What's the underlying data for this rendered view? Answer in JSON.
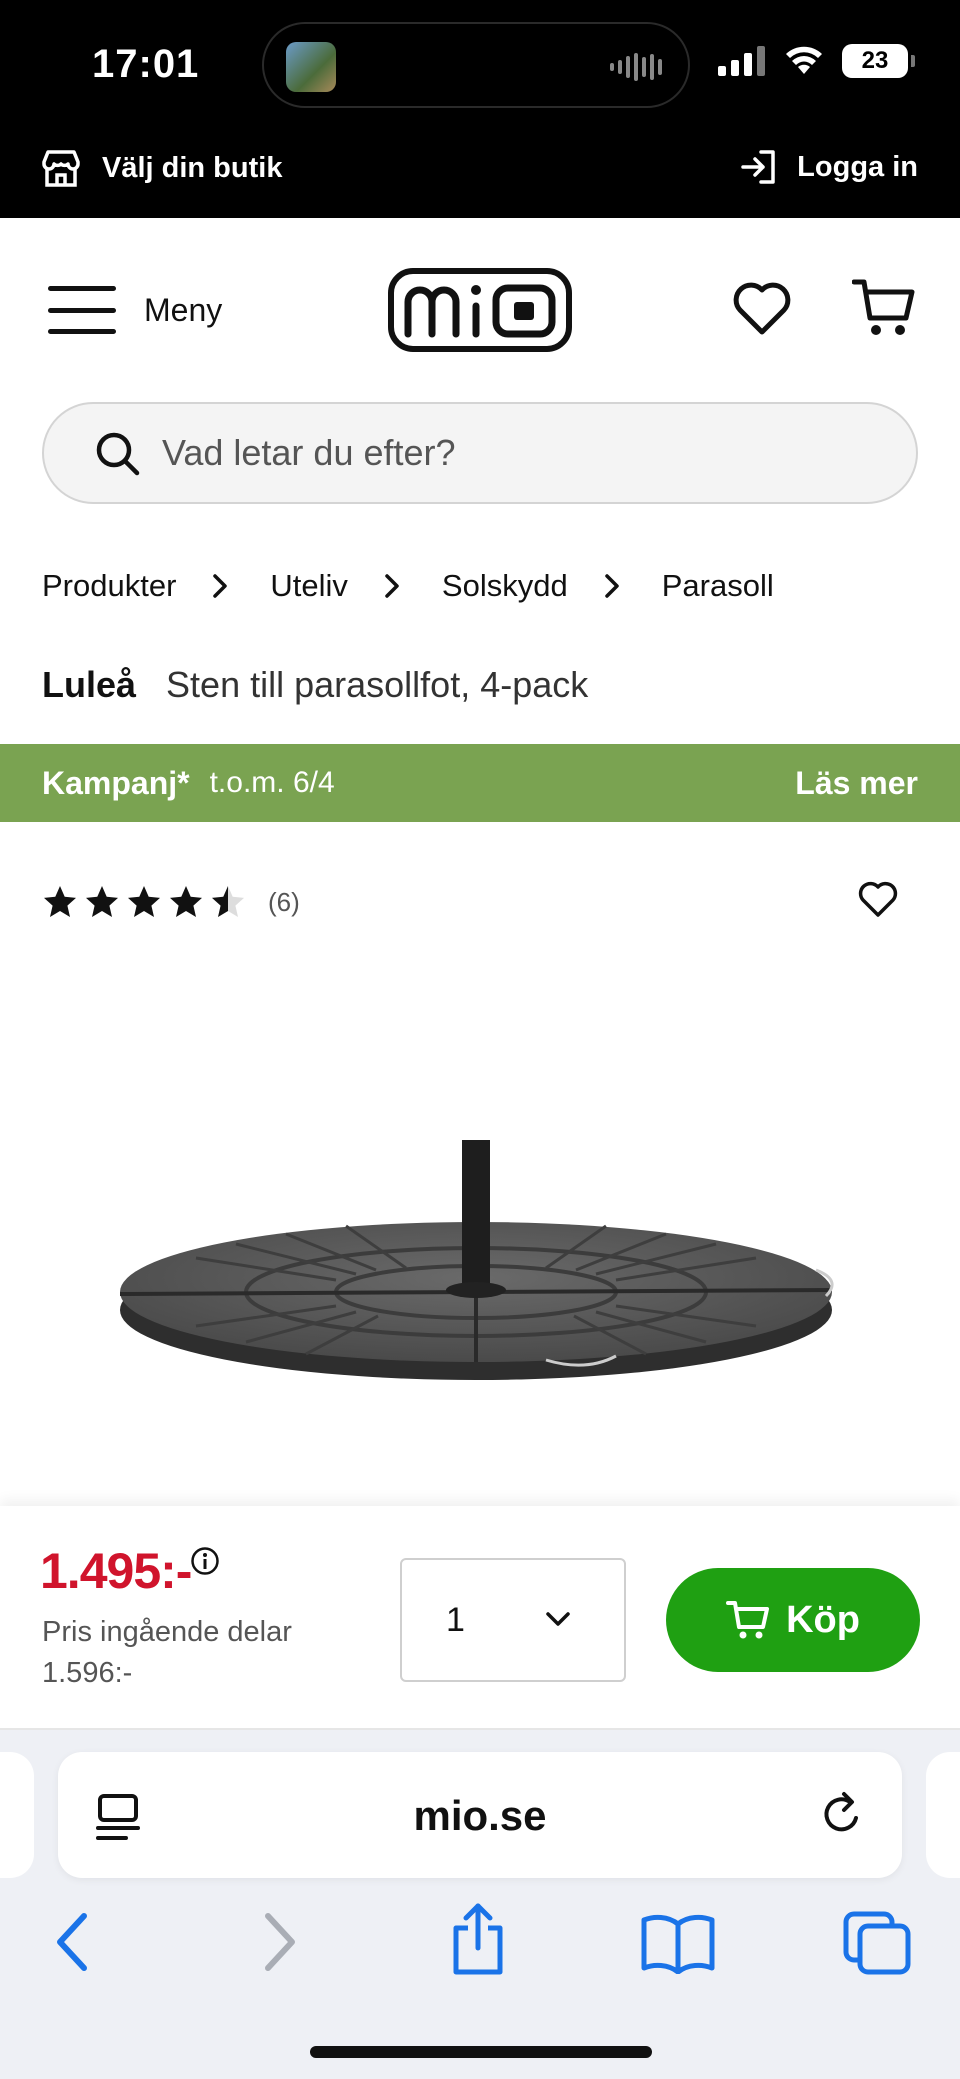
{
  "status_bar": {
    "time": "17:01",
    "battery": "23"
  },
  "store_bar": {
    "choose_store": "Välj din butik",
    "login": "Logga in"
  },
  "header": {
    "menu_label": "Meny",
    "logo_alt": "mio"
  },
  "search": {
    "placeholder": "Vad letar du efter?"
  },
  "breadcrumb": {
    "items": [
      "Produkter",
      "Uteliv",
      "Solskydd",
      "Parasoll"
    ]
  },
  "product": {
    "brand": "Luleå",
    "name": "Sten till parasollfot, 4-pack",
    "rating": 4.5,
    "rating_count": "(6)"
  },
  "campaign": {
    "label": "Kampanj*",
    "date": "t.o.m. 6/4",
    "read_more": "Läs mer",
    "color": "#7aa351"
  },
  "buy_bar": {
    "price": "1.495:-",
    "price_sub_line1": "Pris ingående delar",
    "price_sub_line2": "1.596:-",
    "quantity": "1",
    "buy_label": "Köp",
    "price_color": "#d0142c",
    "buy_color": "#1fa012"
  },
  "browser": {
    "url": "mio.se"
  }
}
